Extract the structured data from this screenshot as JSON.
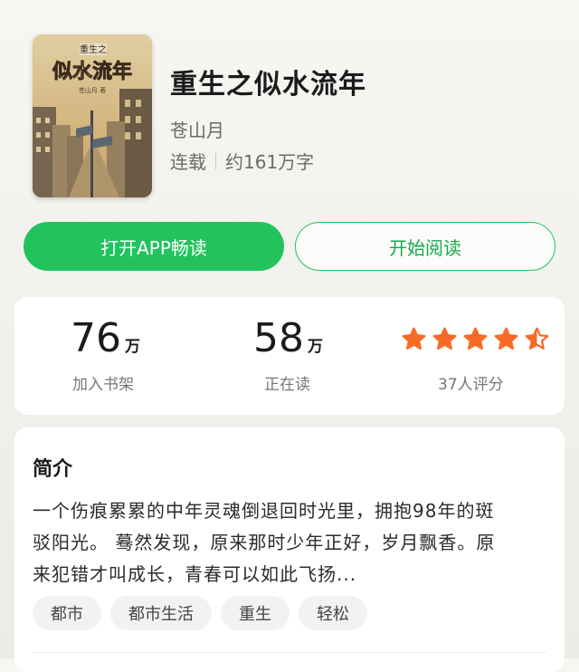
{
  "book": {
    "title": "重生之似水流年",
    "author": "苍山月",
    "status": "连载",
    "word_count": "约161万字",
    "cover": {
      "top_text": "重生之",
      "main_text": "似水流年",
      "author_text": "苍山月 著"
    }
  },
  "actions": {
    "open_app": "打开APP畅读",
    "start_reading": "开始阅读"
  },
  "stats": {
    "shelf": {
      "num": "76",
      "unit": "万",
      "label": "加入书架"
    },
    "reading": {
      "num": "58",
      "unit": "万",
      "label": "正在读"
    },
    "rating": {
      "stars": 4.5,
      "max": 5,
      "label": "37人评分"
    }
  },
  "intro": {
    "heading": "简介",
    "lines": [
      "一个伤痕累累的中年灵魂倒退回时光里，拥抱98年的斑",
      "驳阳光。 蓦然发现，原来那时少年正好，岁月飘香。原",
      "来犯错才叫成长，青春可以如此飞扬..."
    ],
    "tags": [
      "都市",
      "都市生活",
      "重生",
      "轻松"
    ]
  },
  "colors": {
    "accent": "#22c35d",
    "star": "#f86b26"
  }
}
